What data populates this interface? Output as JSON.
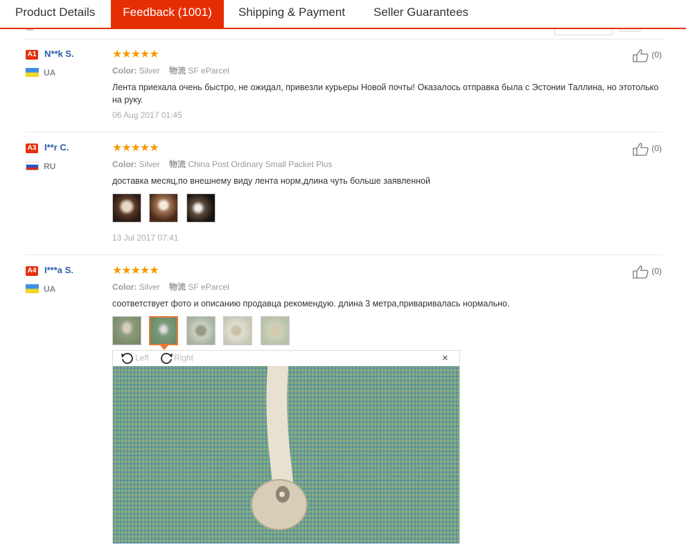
{
  "tabs": [
    {
      "label": "Product Details"
    },
    {
      "label": "Feedback (1001)"
    },
    {
      "label": "Shipping & Payment"
    },
    {
      "label": "Seller Guarantees"
    }
  ],
  "reviews": [
    {
      "badge": "A1",
      "name": "N**k S.",
      "country": "UA",
      "stars": "★★★★★",
      "color_label": "Color:",
      "color_value": "Silver",
      "logistics_label": "物流",
      "logistics_value": "SF eParcel",
      "text": "Лента приехала очень быстро, не ожидал, привезли курьеры Новой почты! Оказалось отправка была с Эстонии Таллина, но этотолько на руку.",
      "date": "06 Aug 2017 01:45",
      "likes": "(0)"
    },
    {
      "badge": "A3",
      "name": "I**r C.",
      "country": "RU",
      "stars": "★★★★★",
      "color_label": "Color:",
      "color_value": "Silver",
      "logistics_label": "物流",
      "logistics_value": "China Post Ordinary Small Packet Plus",
      "text": "доставка месяц,по внешнему виду лента норм,длина чуть больше заявленной",
      "date": "13 Jul 2017 07:41",
      "likes": "(0)"
    },
    {
      "badge": "A4",
      "name": "I***a S.",
      "country": "UA",
      "stars": "★★★★★",
      "color_label": "Color:",
      "color_value": "Silver",
      "logistics_label": "物流",
      "logistics_value": "SF eParcel",
      "text": "соответствует фото и описанию продавца рекомендую. длина 3 метра,приваривалась нормально.",
      "likes": "(0)"
    }
  ],
  "viewer": {
    "rotate_left": "Left",
    "rotate_right": "Right",
    "close": "×"
  },
  "colors": {
    "accent": "#e62e04",
    "star": "#f59b00",
    "name": "#2a5ca8"
  }
}
